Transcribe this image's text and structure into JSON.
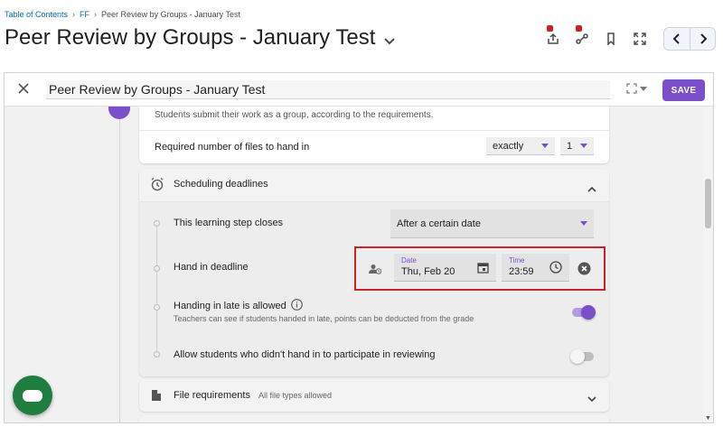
{
  "breadcrumb": {
    "items": [
      "Table of Contents",
      "FF"
    ],
    "current": "Peer Review by Groups - January Test",
    "separator": "›"
  },
  "page": {
    "title": "Peer Review by Groups - January Test"
  },
  "dialog": {
    "title_value": "Peer Review by Groups - January Test",
    "save_label": "SAVE"
  },
  "submission": {
    "description": "Students submit their work as a group, according to the requirements.",
    "required_files_label": "Required number of files to hand in",
    "mode_value": "exactly",
    "count_value": "1"
  },
  "scheduling": {
    "header": "Scheduling deadlines",
    "closes_label": "This learning step closes",
    "closes_value": "After a certain date",
    "handin_label": "Hand in deadline",
    "date_label": "Date",
    "date_value": "Thu, Feb 20",
    "time_label": "Time",
    "time_value": "23:59",
    "late_label": "Handing in late is allowed",
    "late_sub": "Teachers can see if students handed in late, points can be deducted from the grade",
    "late_enabled": true,
    "review_label": "Allow students who didn't hand in to participate in reviewing",
    "review_enabled": false
  },
  "file_requirements": {
    "header": "File requirements",
    "sub": "All file types allowed"
  },
  "colors": {
    "accent": "#7b4fc9",
    "highlight": "#c4232b",
    "chat": "#1e7d3f"
  }
}
